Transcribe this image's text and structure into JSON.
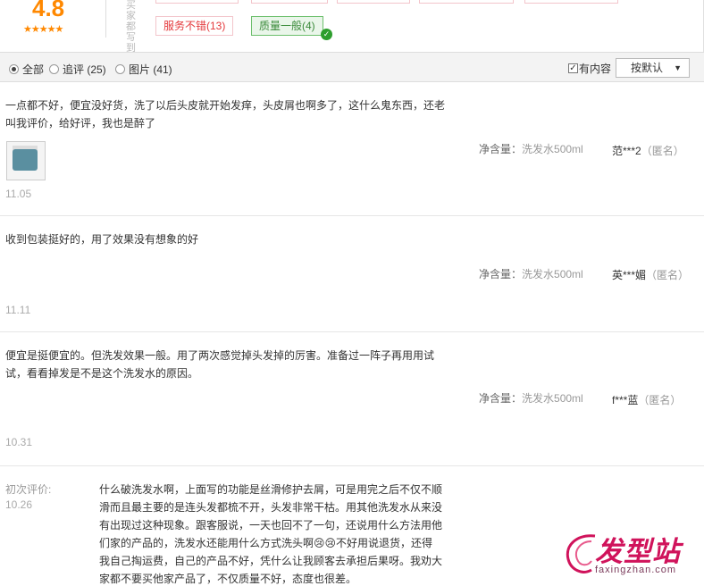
{
  "summary": {
    "score": "4.8",
    "stars": "★★★★★",
    "side_text": "买家都写到",
    "tags": [
      {
        "label": "服务不错(13)",
        "state": "normal"
      },
      {
        "label": "质量一般(4)",
        "state": "selected"
      }
    ]
  },
  "filter": {
    "options": [
      {
        "label": "全部",
        "checked": true
      },
      {
        "label": "追评 (25)",
        "checked": false
      },
      {
        "label": "图片 (41)",
        "checked": false
      }
    ],
    "has_content_label": "有内容",
    "has_content_checked": true,
    "sort_label": "按默认"
  },
  "reviews": [
    {
      "text": "一点都不好，便宜没好货，洗了以后头皮就开始发痒，头皮屑也啊多了，这什么鬼东西，还老叫我评价，给好评，我也是醉了",
      "spec_key": "净含量：",
      "spec_val": "洗发水500ml",
      "user": "范***2",
      "anon": "（匿名）",
      "date": "11.05",
      "has_image": true
    },
    {
      "text": "收到包装挺好的，用了效果没有想象的好",
      "spec_key": "净含量：",
      "spec_val": "洗发水500ml",
      "user": "英***媚",
      "anon": "（匿名）",
      "date": "11.11"
    },
    {
      "text": "便宜是挺便宜的。但洗发效果一般。用了两次感觉掉头发掉的厉害。准备过一阵子再用用试试，看看掉发是不是这个洗发水的原因。",
      "spec_key": "净含量：",
      "spec_val": "洗发水500ml",
      "user": "f***蓝",
      "anon": "（匿名）",
      "date": "10.31"
    }
  ],
  "initial_review": {
    "label": "初次评价:",
    "date": "10.26",
    "text": "什么破洗发水啊，上面写的功能是丝滑修护去屑，可是用完之后不仅不顺滑而且最主要的是连头发都梳不开，头发非常干枯。用其他洗发水从来没有出现过这种现象。跟客服说，一天也回不了一句，还说用什么方法用他们家的产品的，洗发水还能用什么方式洗头啊😢😢不好用说退货，还得我自己掏运费，自己的产品不好，凭什么让我顾客去承担后果呀。我劝大家都不要买他家产品了，不仅质量不好，态度也很差。"
  },
  "watermark": {
    "main": "发型站",
    "sub": "faxingzhan.com"
  },
  "colors": {
    "score": "#ff8800",
    "tag_bad": "#e4393c",
    "tag_selected_bg": "#eaf6ea",
    "watermark": "#d0135b"
  }
}
